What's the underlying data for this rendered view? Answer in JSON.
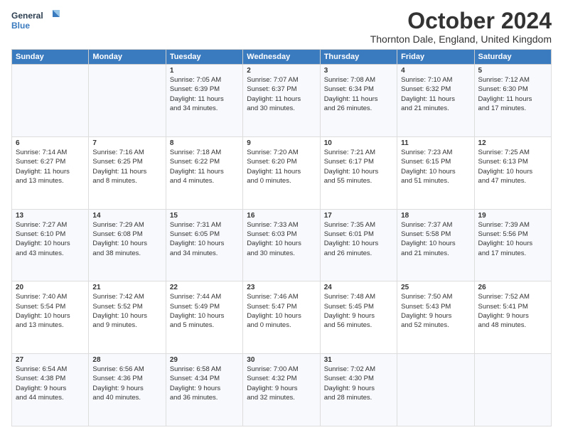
{
  "header": {
    "logo_line1": "General",
    "logo_line2": "Blue",
    "month_title": "October 2024",
    "location": "Thornton Dale, England, United Kingdom"
  },
  "days_of_week": [
    "Sunday",
    "Monday",
    "Tuesday",
    "Wednesday",
    "Thursday",
    "Friday",
    "Saturday"
  ],
  "weeks": [
    [
      {
        "day": "",
        "detail": ""
      },
      {
        "day": "",
        "detail": ""
      },
      {
        "day": "1",
        "detail": "Sunrise: 7:05 AM\nSunset: 6:39 PM\nDaylight: 11 hours\nand 34 minutes."
      },
      {
        "day": "2",
        "detail": "Sunrise: 7:07 AM\nSunset: 6:37 PM\nDaylight: 11 hours\nand 30 minutes."
      },
      {
        "day": "3",
        "detail": "Sunrise: 7:08 AM\nSunset: 6:34 PM\nDaylight: 11 hours\nand 26 minutes."
      },
      {
        "day": "4",
        "detail": "Sunrise: 7:10 AM\nSunset: 6:32 PM\nDaylight: 11 hours\nand 21 minutes."
      },
      {
        "day": "5",
        "detail": "Sunrise: 7:12 AM\nSunset: 6:30 PM\nDaylight: 11 hours\nand 17 minutes."
      }
    ],
    [
      {
        "day": "6",
        "detail": "Sunrise: 7:14 AM\nSunset: 6:27 PM\nDaylight: 11 hours\nand 13 minutes."
      },
      {
        "day": "7",
        "detail": "Sunrise: 7:16 AM\nSunset: 6:25 PM\nDaylight: 11 hours\nand 8 minutes."
      },
      {
        "day": "8",
        "detail": "Sunrise: 7:18 AM\nSunset: 6:22 PM\nDaylight: 11 hours\nand 4 minutes."
      },
      {
        "day": "9",
        "detail": "Sunrise: 7:20 AM\nSunset: 6:20 PM\nDaylight: 11 hours\nand 0 minutes."
      },
      {
        "day": "10",
        "detail": "Sunrise: 7:21 AM\nSunset: 6:17 PM\nDaylight: 10 hours\nand 55 minutes."
      },
      {
        "day": "11",
        "detail": "Sunrise: 7:23 AM\nSunset: 6:15 PM\nDaylight: 10 hours\nand 51 minutes."
      },
      {
        "day": "12",
        "detail": "Sunrise: 7:25 AM\nSunset: 6:13 PM\nDaylight: 10 hours\nand 47 minutes."
      }
    ],
    [
      {
        "day": "13",
        "detail": "Sunrise: 7:27 AM\nSunset: 6:10 PM\nDaylight: 10 hours\nand 43 minutes."
      },
      {
        "day": "14",
        "detail": "Sunrise: 7:29 AM\nSunset: 6:08 PM\nDaylight: 10 hours\nand 38 minutes."
      },
      {
        "day": "15",
        "detail": "Sunrise: 7:31 AM\nSunset: 6:05 PM\nDaylight: 10 hours\nand 34 minutes."
      },
      {
        "day": "16",
        "detail": "Sunrise: 7:33 AM\nSunset: 6:03 PM\nDaylight: 10 hours\nand 30 minutes."
      },
      {
        "day": "17",
        "detail": "Sunrise: 7:35 AM\nSunset: 6:01 PM\nDaylight: 10 hours\nand 26 minutes."
      },
      {
        "day": "18",
        "detail": "Sunrise: 7:37 AM\nSunset: 5:58 PM\nDaylight: 10 hours\nand 21 minutes."
      },
      {
        "day": "19",
        "detail": "Sunrise: 7:39 AM\nSunset: 5:56 PM\nDaylight: 10 hours\nand 17 minutes."
      }
    ],
    [
      {
        "day": "20",
        "detail": "Sunrise: 7:40 AM\nSunset: 5:54 PM\nDaylight: 10 hours\nand 13 minutes."
      },
      {
        "day": "21",
        "detail": "Sunrise: 7:42 AM\nSunset: 5:52 PM\nDaylight: 10 hours\nand 9 minutes."
      },
      {
        "day": "22",
        "detail": "Sunrise: 7:44 AM\nSunset: 5:49 PM\nDaylight: 10 hours\nand 5 minutes."
      },
      {
        "day": "23",
        "detail": "Sunrise: 7:46 AM\nSunset: 5:47 PM\nDaylight: 10 hours\nand 0 minutes."
      },
      {
        "day": "24",
        "detail": "Sunrise: 7:48 AM\nSunset: 5:45 PM\nDaylight: 9 hours\nand 56 minutes."
      },
      {
        "day": "25",
        "detail": "Sunrise: 7:50 AM\nSunset: 5:43 PM\nDaylight: 9 hours\nand 52 minutes."
      },
      {
        "day": "26",
        "detail": "Sunrise: 7:52 AM\nSunset: 5:41 PM\nDaylight: 9 hours\nand 48 minutes."
      }
    ],
    [
      {
        "day": "27",
        "detail": "Sunrise: 6:54 AM\nSunset: 4:38 PM\nDaylight: 9 hours\nand 44 minutes."
      },
      {
        "day": "28",
        "detail": "Sunrise: 6:56 AM\nSunset: 4:36 PM\nDaylight: 9 hours\nand 40 minutes."
      },
      {
        "day": "29",
        "detail": "Sunrise: 6:58 AM\nSunset: 4:34 PM\nDaylight: 9 hours\nand 36 minutes."
      },
      {
        "day": "30",
        "detail": "Sunrise: 7:00 AM\nSunset: 4:32 PM\nDaylight: 9 hours\nand 32 minutes."
      },
      {
        "day": "31",
        "detail": "Sunrise: 7:02 AM\nSunset: 4:30 PM\nDaylight: 9 hours\nand 28 minutes."
      },
      {
        "day": "",
        "detail": ""
      },
      {
        "day": "",
        "detail": ""
      }
    ]
  ]
}
